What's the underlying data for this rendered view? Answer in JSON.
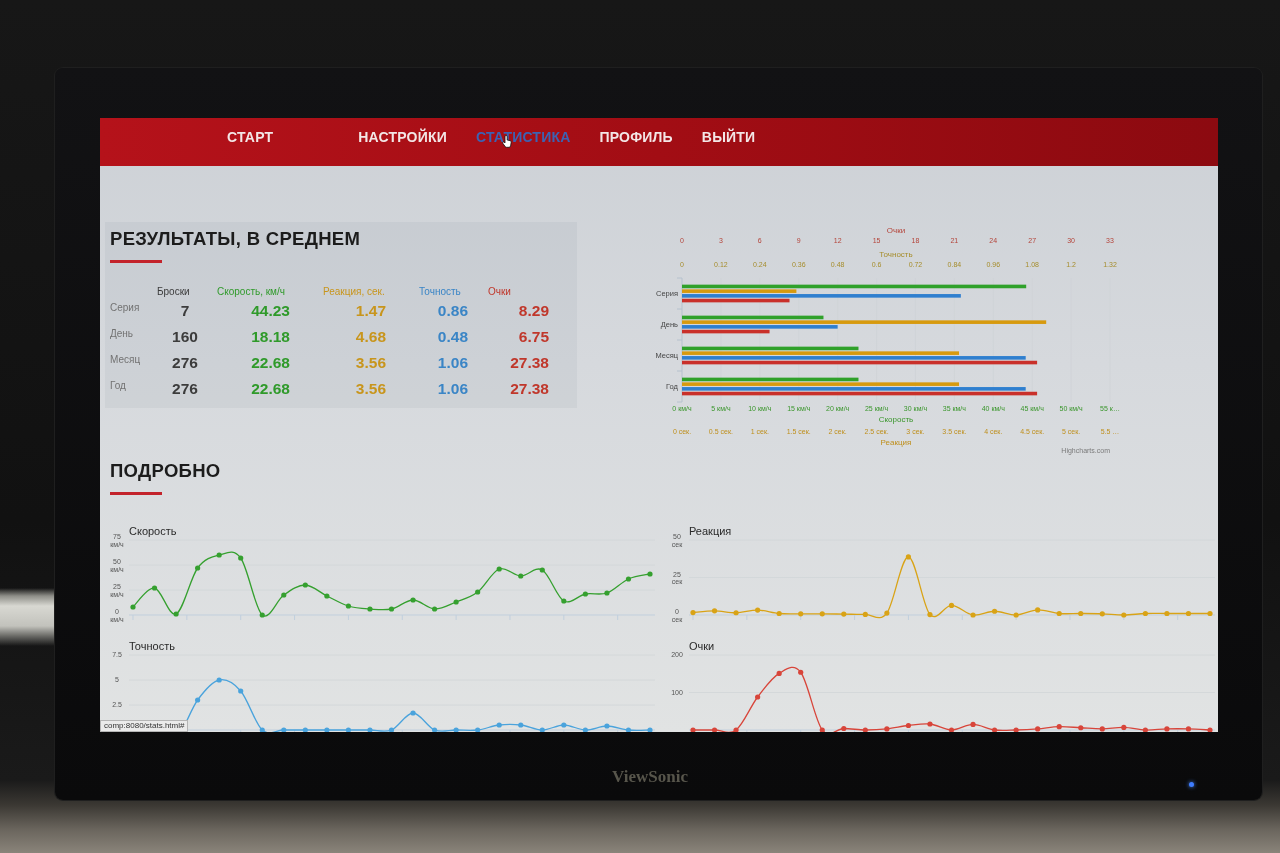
{
  "nav": {
    "items": [
      {
        "label": "СТАРТ",
        "selected": false
      },
      {
        "label": "НАСТРОЙКИ",
        "selected": false
      },
      {
        "label": "СТАТИСТИКА",
        "selected": true
      },
      {
        "label": "ПРОФИЛЬ",
        "selected": false
      },
      {
        "label": "ВЫЙТИ",
        "selected": false
      }
    ]
  },
  "averages": {
    "title": "РЕЗУЛЬТАТЫ, В СРЕДНЕМ",
    "columns": [
      {
        "label": "Броски",
        "color": "#3c3c3c"
      },
      {
        "label": "Скорость, км/ч",
        "color": "#2f9a2a"
      },
      {
        "label": "Реакция, сек.",
        "color": "#c8951c"
      },
      {
        "label": "Точность",
        "color": "#3a85c6"
      },
      {
        "label": "Очки",
        "color": "#c0372b"
      }
    ],
    "rows": [
      {
        "label": "Серия",
        "cells": [
          "7",
          "44.23",
          "1.47",
          "0.86",
          "8.29"
        ]
      },
      {
        "label": "День",
        "cells": [
          "160",
          "18.18",
          "4.68",
          "0.48",
          "6.75"
        ]
      },
      {
        "label": "Месяц",
        "cells": [
          "276",
          "22.68",
          "3.56",
          "1.06",
          "27.38"
        ]
      },
      {
        "label": "Год",
        "cells": [
          "276",
          "22.68",
          "3.56",
          "1.06",
          "27.38"
        ]
      }
    ]
  },
  "averages_chart": {
    "top_axes": {
      "chart_data": {
        "type": "bar",
        "orientation": "horizontal",
        "xlabel": "Очки",
        "xlim": [
          0,
          33
        ],
        "xticks": [
          {
            "value": 0,
            "label": "0"
          },
          {
            "value": 3,
            "label": "3"
          },
          {
            "value": 6,
            "label": "6"
          },
          {
            "value": 9,
            "label": "9"
          },
          {
            "value": 12,
            "label": "12"
          },
          {
            "value": 15,
            "label": "15"
          },
          {
            "value": 18,
            "label": "18"
          },
          {
            "value": 21,
            "label": "21"
          },
          {
            "value": 24,
            "label": "24"
          },
          {
            "value": 27,
            "label": "27"
          },
          {
            "value": 30,
            "label": "30"
          },
          {
            "value": 33,
            "label": "33"
          }
        ],
        "x2label": "Точность",
        "x2lim": [
          0,
          1.32
        ],
        "x2ticks": [
          {
            "value": 0,
            "label": "0"
          },
          {
            "value": 0.12,
            "label": "0.12"
          },
          {
            "value": 0.24,
            "label": "0.24"
          },
          {
            "value": 0.36,
            "label": "0.36"
          },
          {
            "value": 0.48,
            "label": "0.48"
          },
          {
            "value": 0.6,
            "label": "0.6"
          },
          {
            "value": 0.72,
            "label": "0.72"
          },
          {
            "value": 0.84,
            "label": "0.84"
          },
          {
            "value": 0.96,
            "label": "0.96"
          },
          {
            "value": 1.08,
            "label": "1.08"
          },
          {
            "value": 1.2,
            "label": "1.2"
          },
          {
            "value": 1.32,
            "label": "1.32"
          }
        ],
        "series": [
          {
            "color": "#2f7fcf",
            "axis": "x2",
            "values": [
              0.86,
              0.48,
              1.06,
              1.06
            ]
          },
          {
            "color": "#c9302a",
            "values": [
              8.29,
              6.75,
              27.38,
              27.38
            ]
          }
        ]
      }
    },
    "chart_data": {
      "type": "bar",
      "orientation": "horizontal",
      "grid": true,
      "categories": [
        "Серия",
        "День",
        "Месяц",
        "Год"
      ],
      "xlabel": "Скорость",
      "xlim": [
        0,
        55
      ],
      "xticks": [
        {
          "value": 0,
          "label": "0 км/ч"
        },
        {
          "value": 5,
          "label": "5 км/ч"
        },
        {
          "value": 10,
          "label": "10 км/ч"
        },
        {
          "value": 15,
          "label": "15 км/ч"
        },
        {
          "value": 20,
          "label": "20 км/ч"
        },
        {
          "value": 25,
          "label": "25 км/ч"
        },
        {
          "value": 30,
          "label": "30 км/ч"
        },
        {
          "value": 35,
          "label": "35 км/ч"
        },
        {
          "value": 40,
          "label": "40 км/ч"
        },
        {
          "value": 45,
          "label": "45 км/ч"
        },
        {
          "value": 50,
          "label": "50 км/ч"
        },
        {
          "value": 55,
          "label": "55 к…"
        }
      ],
      "x2label": "Реакция",
      "x2lim": [
        0,
        5.5
      ],
      "x2ticks": [
        {
          "value": 0,
          "label": "0 сек."
        },
        {
          "value": 0.5,
          "label": "0.5 сек."
        },
        {
          "value": 1,
          "label": "1 сек."
        },
        {
          "value": 1.5,
          "label": "1.5 сек."
        },
        {
          "value": 2,
          "label": "2 сек."
        },
        {
          "value": 2.5,
          "label": "2.5 сек."
        },
        {
          "value": 3,
          "label": "3 сек."
        },
        {
          "value": 3.5,
          "label": "3.5 сек."
        },
        {
          "value": 4,
          "label": "4 сек."
        },
        {
          "value": 4.5,
          "label": "4.5 сек."
        },
        {
          "value": 5,
          "label": "5 сек."
        },
        {
          "value": 5.5,
          "label": "5.5 …"
        }
      ],
      "series": [
        {
          "color": "#2fa12a",
          "values": [
            44.23,
            18.18,
            22.68,
            22.68
          ]
        },
        {
          "color": "#d79a0e",
          "axis": "x2",
          "values": [
            1.47,
            4.68,
            3.56,
            3.56
          ]
        }
      ]
    },
    "credits": "Highcharts.com"
  },
  "details": {
    "title": "ПОДРОБНО",
    "charts": [
      {
        "chart_data": {
          "type": "line",
          "title": "Скорость",
          "grid": true,
          "ylim": [
            0,
            75
          ],
          "yticks": [
            {
              "value": 0,
              "label": "0 км/ч"
            },
            {
              "value": 25,
              "label": "25 км/ч"
            },
            {
              "value": 50,
              "label": "50 км/ч"
            },
            {
              "value": 75,
              "label": "75 км/ч"
            }
          ],
          "series": [
            {
              "color": "#35a02f",
              "values": [
                8,
                27,
                1,
                47,
                60,
                57,
                0,
                20,
                30,
                19,
                9,
                6,
                6,
                15,
                6,
                13,
                23,
                46,
                39,
                45,
                14,
                21,
                22,
                36,
                41
              ]
            }
          ]
        }
      },
      {
        "chart_data": {
          "type": "line",
          "title": "Реакция",
          "grid": true,
          "ylim": [
            0,
            50
          ],
          "yticks": [
            {
              "value": 0,
              "label": "0 сек"
            },
            {
              "value": 25,
              "label": "25 сек"
            },
            {
              "value": 50,
              "label": "50 сек"
            }
          ],
          "series": [
            {
              "color": "#d9a316",
              "values": [
                1.6,
                2.8,
                1.5,
                3.3,
                1,
                0.8,
                0.8,
                0.6,
                0.4,
                1.3,
                38.7,
                0.3,
                6.4,
                0,
                2.5,
                0,
                3.4,
                1,
                1,
                0.8,
                0,
                1,
                1,
                1,
                1
              ]
            }
          ]
        }
      },
      {
        "chart_data": {
          "type": "line",
          "title": "Точность",
          "grid": true,
          "ylim": [
            0,
            7.5
          ],
          "yticks": [
            {
              "value": 2.5,
              "label": "2.5"
            },
            {
              "value": 5,
              "label": "5"
            },
            {
              "value": 7.5,
              "label": "7.5"
            }
          ],
          "series": [
            {
              "color": "#4aa3dc",
              "values": [
                null,
                null,
                null,
                3,
                5,
                3.9,
                0,
                0,
                0,
                0,
                0,
                0,
                0,
                1.7,
                0,
                0,
                0,
                0.5,
                0.5,
                0,
                0.5,
                0,
                0.4,
                0,
                0
              ]
            }
          ]
        }
      },
      {
        "chart_data": {
          "type": "line",
          "title": "Очки",
          "grid": true,
          "ylim": [
            0,
            200
          ],
          "yticks": [
            {
              "value": 100,
              "label": "100"
            },
            {
              "value": 200,
              "label": "200"
            }
          ],
          "series": [
            {
              "color": "#d8453a",
              "values": [
                0,
                0,
                0,
                88,
                151,
                154,
                0,
                4,
                0,
                3,
                12,
                16,
                0,
                15,
                0,
                0,
                3,
                9,
                6,
                3,
                7,
                0,
                3,
                3,
                0
              ]
            }
          ]
        }
      }
    ]
  },
  "status_bar": {
    "url": "comp:8080/stats.html#"
  },
  "monitor": {
    "brand": "ViewSonic"
  }
}
